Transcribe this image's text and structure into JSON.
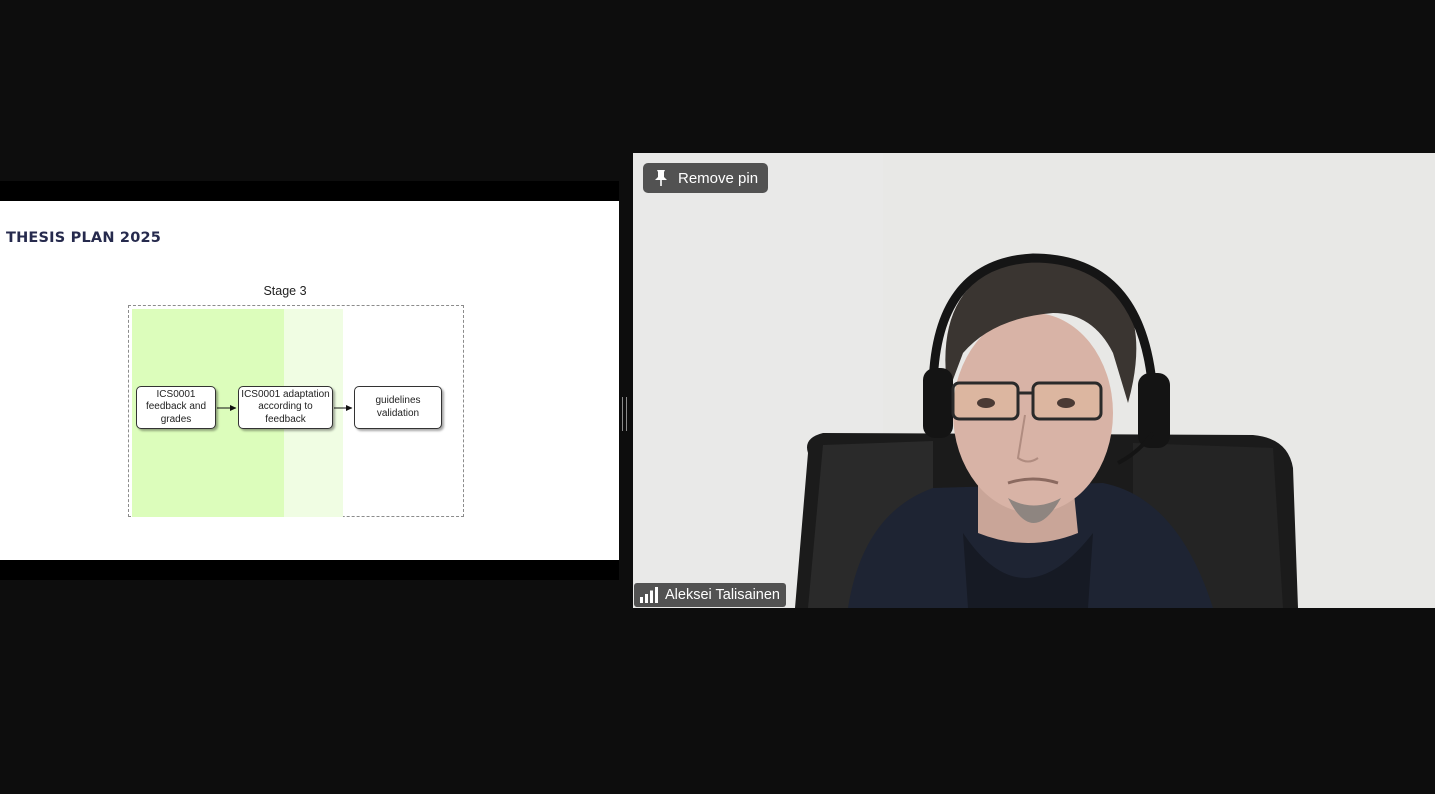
{
  "shared_screen": {
    "slide_title": "THESIS PLAN 2025",
    "stage_label": "Stage 3",
    "flow_nodes": [
      {
        "label": "ICS0001 feedback and grades"
      },
      {
        "label": "ICS0001 adaptation according to feedback"
      },
      {
        "label": "guidelines validation"
      }
    ]
  },
  "video": {
    "pin_button_label": "Remove pin",
    "pin_icon": "pin-icon",
    "participant_name": "Aleksei Talisainen",
    "signal_icon": "signal-strength-icon"
  },
  "colors": {
    "background": "#0d0d0d",
    "slide_title": "#262a4d",
    "band_green": "#dcfdbb",
    "band_light_green": "#f0fde3"
  }
}
